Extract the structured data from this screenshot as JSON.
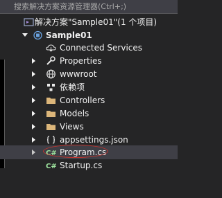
{
  "search": {
    "placeholder": "搜索解决方案资源管理器(Ctrl+;)"
  },
  "solution": {
    "label": "解决方案\"Sample01\"(1 个项目)"
  },
  "project": {
    "label": "Sample01"
  },
  "items": [
    {
      "label": "Connected Services",
      "icon": "connected-services-icon"
    },
    {
      "label": "Properties",
      "icon": "wrench-icon"
    },
    {
      "label": "wwwroot",
      "icon": "globe-icon"
    },
    {
      "label": "依赖项",
      "icon": "dependencies-icon"
    },
    {
      "label": "Controllers",
      "icon": "folder-icon"
    },
    {
      "label": "Models",
      "icon": "folder-icon"
    },
    {
      "label": "Views",
      "icon": "folder-icon"
    },
    {
      "label": "appsettings.json",
      "icon": "json-file-icon"
    },
    {
      "label": "Program.cs",
      "icon": "csharp-file-icon"
    },
    {
      "label": "Startup.cs",
      "icon": "csharp-file-icon"
    }
  ],
  "colors": {
    "background": "#252526",
    "folder": "#dcb67a",
    "csharp": "#9ee39e",
    "highlight": "#c0342f"
  }
}
